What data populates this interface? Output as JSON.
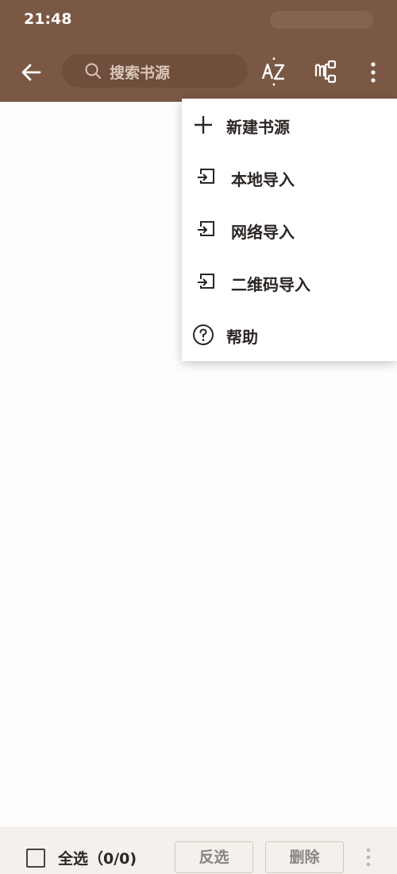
{
  "status_bar": {
    "time": "21:48"
  },
  "toolbar": {
    "search_placeholder": "搜索书源",
    "icons": {
      "back": "arrow-left-icon",
      "search": "search-icon",
      "sort": "sort-az-icon",
      "group": "group-icon",
      "more": "more-vertical-icon"
    }
  },
  "menu": {
    "items": [
      {
        "label": "新建书源",
        "icon": "plus-icon"
      },
      {
        "label": "本地导入",
        "icon": "import-icon"
      },
      {
        "label": "网络导入",
        "icon": "import-icon"
      },
      {
        "label": "二维码导入",
        "icon": "import-icon"
      },
      {
        "label": "帮助",
        "icon": "help-circle-icon"
      }
    ]
  },
  "bottom_bar": {
    "select_all_label": "全选（0/0)",
    "invert_label": "反选",
    "delete_label": "删除"
  },
  "colors": {
    "toolbar": "#7a5844",
    "search_box": "#6f4e3b",
    "background": "#fefdfb",
    "bottom_bar": "#f4f1ec"
  }
}
